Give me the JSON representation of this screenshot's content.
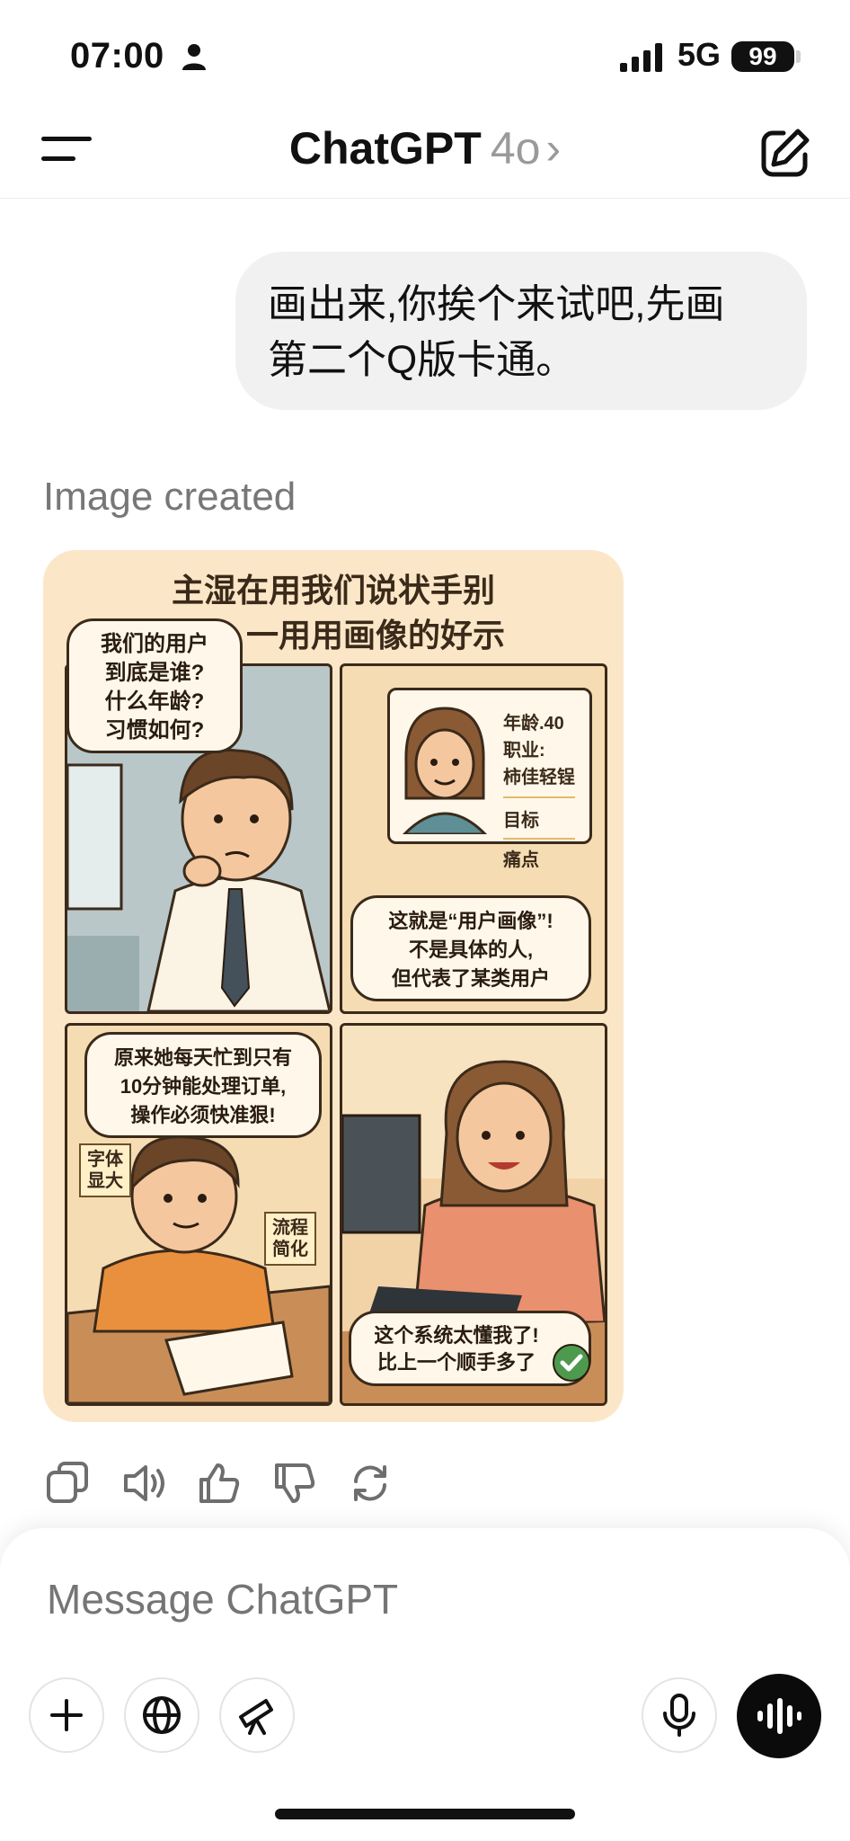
{
  "status_bar": {
    "time": "07:00",
    "network": "5G",
    "battery": "99",
    "icons": [
      "person-icon",
      "signal-icon"
    ]
  },
  "header": {
    "title": "ChatGPT",
    "model": "4o",
    "chevron": "›",
    "icons": [
      "menu-icon",
      "new-chat-icon"
    ]
  },
  "conversation": {
    "user_message_lines": [
      "画出来,你挨个来试吧,先画",
      "第二个Q版卡通。"
    ],
    "image_status": "Image created",
    "comic": {
      "title_lines": [
        "主湿在用我们说状手别",
        "一用用画像的好示"
      ],
      "panel1_bubble": [
        "我们的用户",
        "到底是谁?",
        "什么年龄?",
        "习惯如何?"
      ],
      "panel2_card": [
        "年龄.40",
        "职业:",
        "柿佳轻锃",
        "目标",
        "痛点"
      ],
      "panel2_bubble": [
        "这就是“用户画像”!",
        "不是具体的人,",
        "但代表了某类用户"
      ],
      "panel3_bubble": [
        "原来她每天忙到只有",
        "10分钟能处理订单,",
        "操作必须快准狠!"
      ],
      "panel3_note1": [
        "字体",
        "显大"
      ],
      "panel3_note2": [
        "流程",
        "",
        "简化"
      ],
      "panel4_bubble": [
        "这个系统太懂我了!",
        "比上一个顺手多了"
      ]
    }
  },
  "actions": [
    "copy-icon",
    "speaker-icon",
    "thumbs-up-icon",
    "thumbs-down-icon",
    "regenerate-icon"
  ],
  "composer": {
    "placeholder": "Message ChatGPT",
    "buttons": [
      "plus-icon",
      "globe-icon",
      "telescope-icon",
      "microphone-icon",
      "voice-mode-icon"
    ]
  }
}
